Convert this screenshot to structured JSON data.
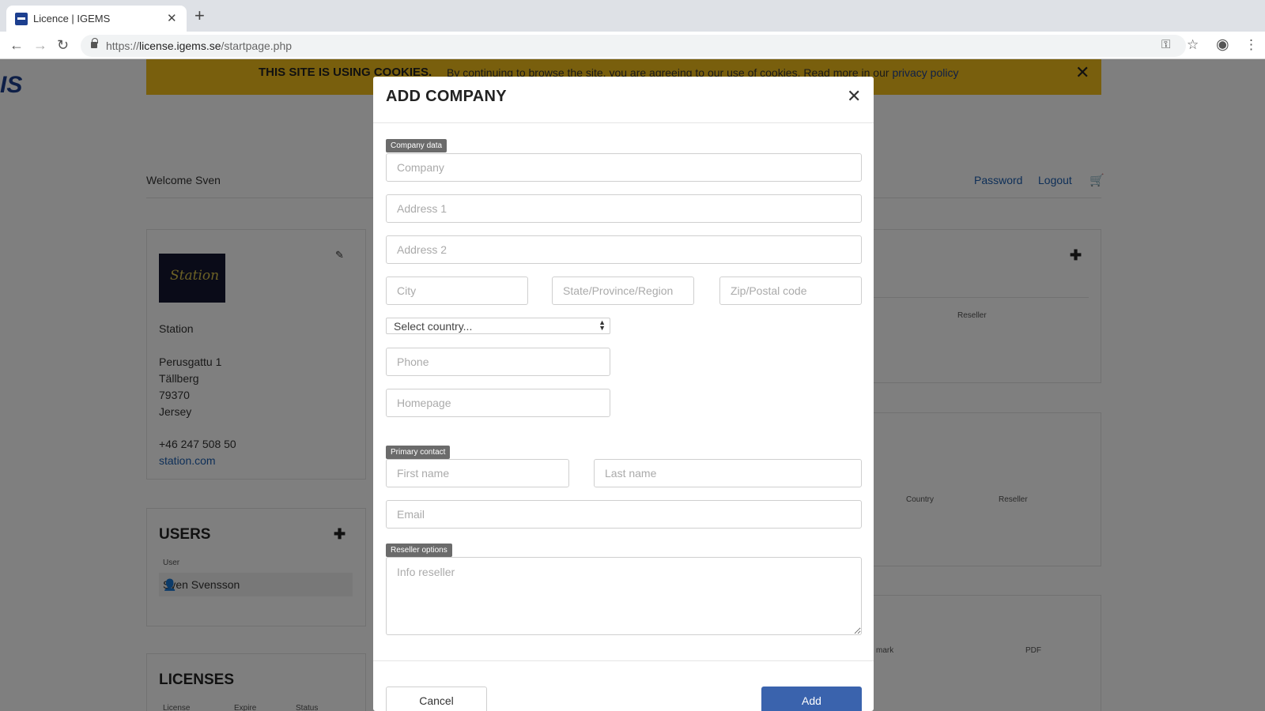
{
  "browser": {
    "tab_title": "Licence | IGEMS",
    "url_prefix": "https://",
    "url_domain": "license.igems.se",
    "url_path": "/startpage.php"
  },
  "page": {
    "logo_fragment": "IS",
    "cookie": {
      "strong": "THIS SITE IS USING COOKIES.",
      "text": "By continuing to browse the site, you are agreeing to our use of cookies. Read more in our",
      "link": "privacy policy"
    },
    "welcome": "Welcome Sven",
    "password_link": "Password",
    "logout_link": "Logout",
    "company": {
      "name": "Station",
      "logo_text": "Station",
      "address1": "Perusgattu 1",
      "city": "Tällberg",
      "zip": "79370",
      "country": "Jersey",
      "phone": "+46 247 508 50",
      "homepage": "station.com"
    },
    "users": {
      "title": "USERS",
      "col_user": "User",
      "rows": [
        "Sven Svensson"
      ]
    },
    "licenses": {
      "title": "LICENSES",
      "cols": [
        "License",
        "Expire",
        "Status"
      ]
    },
    "right_cols": {
      "reseller1": "Reseller",
      "country": "Country",
      "reseller2": "Reseller",
      "remark": "mark",
      "pdf": "PDF"
    }
  },
  "modal": {
    "title": "ADD COMPANY",
    "section_company": "Company data",
    "section_contact": "Primary contact",
    "section_reseller": "Reseller options",
    "placeholders": {
      "company": "Company",
      "address1": "Address 1",
      "address2": "Address 2",
      "city": "City",
      "state": "State/Province/Region",
      "zip": "Zip/Postal code",
      "phone": "Phone",
      "homepage": "Homepage",
      "first_name": "First name",
      "last_name": "Last name",
      "email": "Email",
      "info_reseller": "Info reseller"
    },
    "country_select": "Select country...",
    "cancel": "Cancel",
    "add": "Add"
  }
}
